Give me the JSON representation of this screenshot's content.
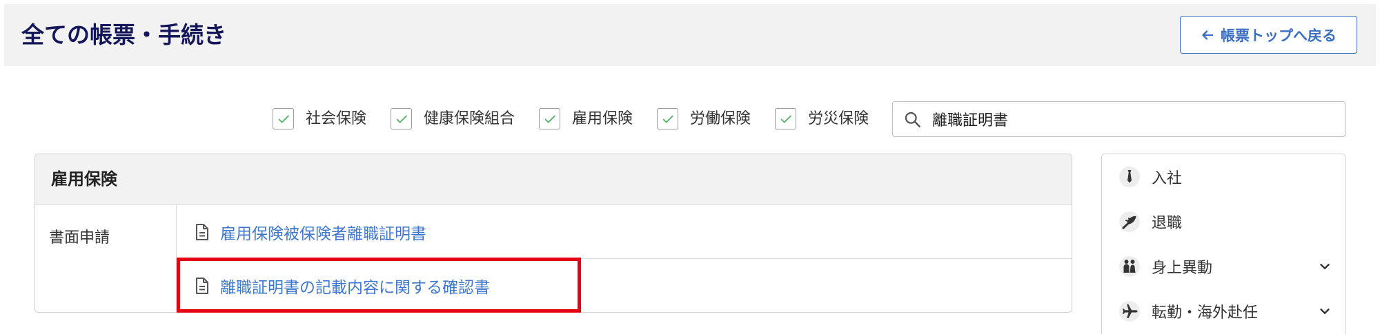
{
  "header": {
    "title": "全ての帳票・手続き",
    "back_label": "帳票トップへ戻る",
    "back_icon": "arrow-left-icon"
  },
  "filters": [
    {
      "label": "社会保険",
      "checked": true
    },
    {
      "label": "健康保険組合",
      "checked": true
    },
    {
      "label": "雇用保険",
      "checked": true
    },
    {
      "label": "労働保険",
      "checked": true
    },
    {
      "label": "労災保険",
      "checked": true
    }
  ],
  "search": {
    "value": "離職証明書",
    "icon": "search-icon"
  },
  "section": {
    "title": "雇用保険",
    "category": "書面申請",
    "links": [
      {
        "label": "雇用保険被保険者離職証明書",
        "icon": "document-icon"
      },
      {
        "label": "離職証明書の記載内容に関する確認書",
        "icon": "document-icon",
        "highlighted": true
      }
    ]
  },
  "sidebar": {
    "items": [
      {
        "label": "入社",
        "icon": "necktie-icon",
        "expandable": false
      },
      {
        "label": "退職",
        "icon": "bouquet-icon",
        "expandable": false
      },
      {
        "label": "身上異動",
        "icon": "family-icon",
        "expandable": true
      },
      {
        "label": "転勤・海外赴任",
        "icon": "airplane-icon",
        "expandable": true
      }
    ]
  },
  "colors": {
    "title": "#14165a",
    "accent": "#3a6fc4",
    "link": "#3f78cf",
    "check": "#58b368",
    "highlight": "#e50012",
    "panel_bg": "#f2f2f2"
  }
}
